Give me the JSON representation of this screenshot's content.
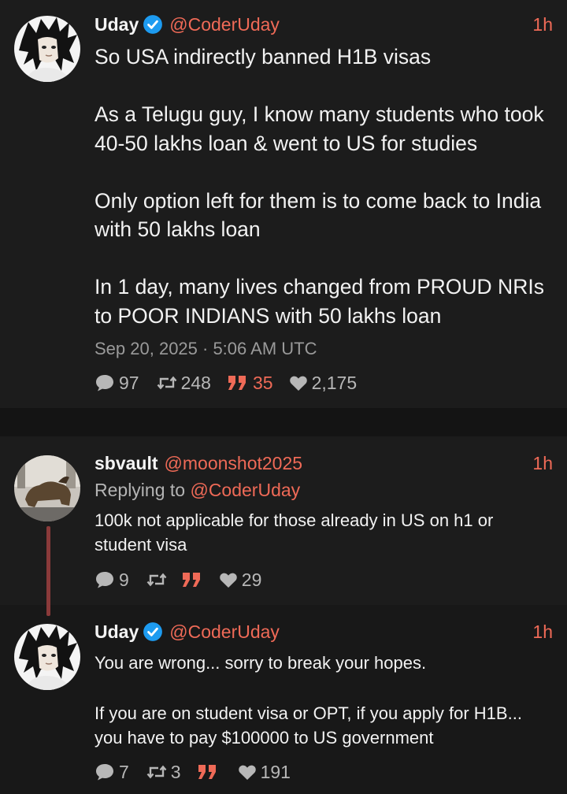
{
  "main_tweet": {
    "name": "Uday",
    "handle": "@CoderUday",
    "time": "1h",
    "paragraphs": [
      "So USA indirectly banned H1B visas",
      "As a Telugu guy, I know many students who took 40-50 lakhs loan & went to US for studies",
      "Only option left for them is to come back to India with 50 lakhs loan",
      "In 1 day, many lives changed from PROUD NRIs to POOR INDIANS with 50 lakhs loan"
    ],
    "date": "Sep 20, 2025 · 5:06 AM UTC",
    "stats": {
      "replies": "97",
      "retweets": "248",
      "quotes": "35",
      "likes": "2,175"
    }
  },
  "reply_1": {
    "name": "sbvault",
    "handle": "@moonshot2025",
    "time": "1h",
    "replying_prefix": "Replying to",
    "replying_to": "@CoderUday",
    "paragraphs": [
      "100k not applicable for those already in US on h1 or student visa"
    ],
    "stats": {
      "replies": "9",
      "retweets": "",
      "quotes": "",
      "likes": "29"
    }
  },
  "reply_2": {
    "name": "Uday",
    "handle": "@CoderUday",
    "time": "1h",
    "paragraphs": [
      "You are wrong... sorry to break your hopes.",
      "If you are on student visa or OPT, if you apply for H1B... you have to pay $100000 to US government"
    ],
    "stats": {
      "replies": "7",
      "retweets": "3",
      "quotes": "",
      "likes": "191"
    }
  },
  "colors": {
    "accent": "#ef6a57",
    "background": "#1c1c1c",
    "verified": "#1d9bf0",
    "thread_line": "#8a3a3a"
  },
  "icons": [
    "comment-icon",
    "retweet-icon",
    "quote-icon",
    "heart-icon",
    "verified-badge-icon"
  ]
}
